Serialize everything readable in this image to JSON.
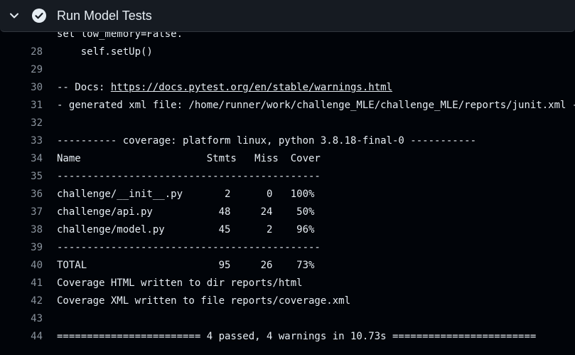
{
  "step": {
    "title": "Run Model Tests",
    "status": "success"
  },
  "partial_line": "set low_memory=False.",
  "log": [
    {
      "n": "28",
      "text": "    self.setUp()"
    },
    {
      "n": "29",
      "text": ""
    },
    {
      "n": "30",
      "text": "-- Docs: ",
      "link": "https://docs.pytest.org/en/stable/warnings.html"
    },
    {
      "n": "31",
      "text": "- generated xml file: /home/runner/work/challenge_MLE/challenge_MLE/reports/junit.xml -"
    },
    {
      "n": "32",
      "text": ""
    },
    {
      "n": "33",
      "text": "---------- coverage: platform linux, python 3.8.18-final-0 -----------"
    },
    {
      "n": "34",
      "text": "Name                     Stmts   Miss  Cover"
    },
    {
      "n": "35",
      "text": "--------------------------------------------"
    },
    {
      "n": "36",
      "text": "challenge/__init__.py       2      0   100%"
    },
    {
      "n": "37",
      "text": "challenge/api.py           48     24    50%"
    },
    {
      "n": "38",
      "text": "challenge/model.py         45      2    96%"
    },
    {
      "n": "39",
      "text": "--------------------------------------------"
    },
    {
      "n": "40",
      "text": "TOTAL                      95     26    73%"
    },
    {
      "n": "41",
      "text": "Coverage HTML written to dir reports/html"
    },
    {
      "n": "42",
      "text": "Coverage XML written to file reports/coverage.xml"
    },
    {
      "n": "43",
      "text": ""
    },
    {
      "n": "44",
      "text": "======================== 4 passed, 4 warnings in 10.73s ========================"
    }
  ],
  "colors": {
    "background": "#010409",
    "header": "#161b22",
    "text": "#e6edf3",
    "line_number": "#8b949e"
  },
  "icons": {
    "collapse": "chevron-down-icon",
    "status": "check-circle-icon"
  }
}
